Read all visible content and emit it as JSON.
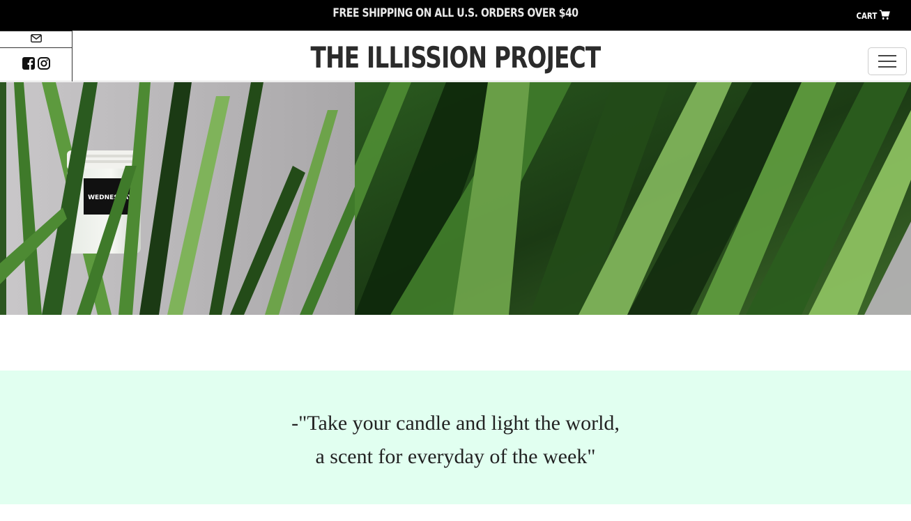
{
  "topbar": {
    "promo_text": "FREE SHIPPING ON ALL U.S. ORDERS OVER $40",
    "cart_label": "CART",
    "cart_icon": "shopping-cart-icon"
  },
  "header": {
    "brand": "THE ILLISSION PROJECT",
    "social_icons": [
      "envelope-icon",
      "facebook-square-icon",
      "instagram-icon"
    ],
    "menu_icon": "hamburger-menu-icon"
  },
  "hero": {
    "jar_label": "WEDNESDAY",
    "colors": {
      "foliage_dark": "#1f3a17",
      "foliage_mid": "#3f7a2a",
      "foliage_light": "#7fb35a",
      "wall": "#b8b6b8"
    }
  },
  "quote": {
    "line1": "-\"Take your candle and light the world,",
    "line2": "a scent for everyday of the week\""
  },
  "colors": {
    "topbar_bg": "#000000",
    "quote_bg": "#e1fff0",
    "brand_text": "#2b2b2b"
  }
}
